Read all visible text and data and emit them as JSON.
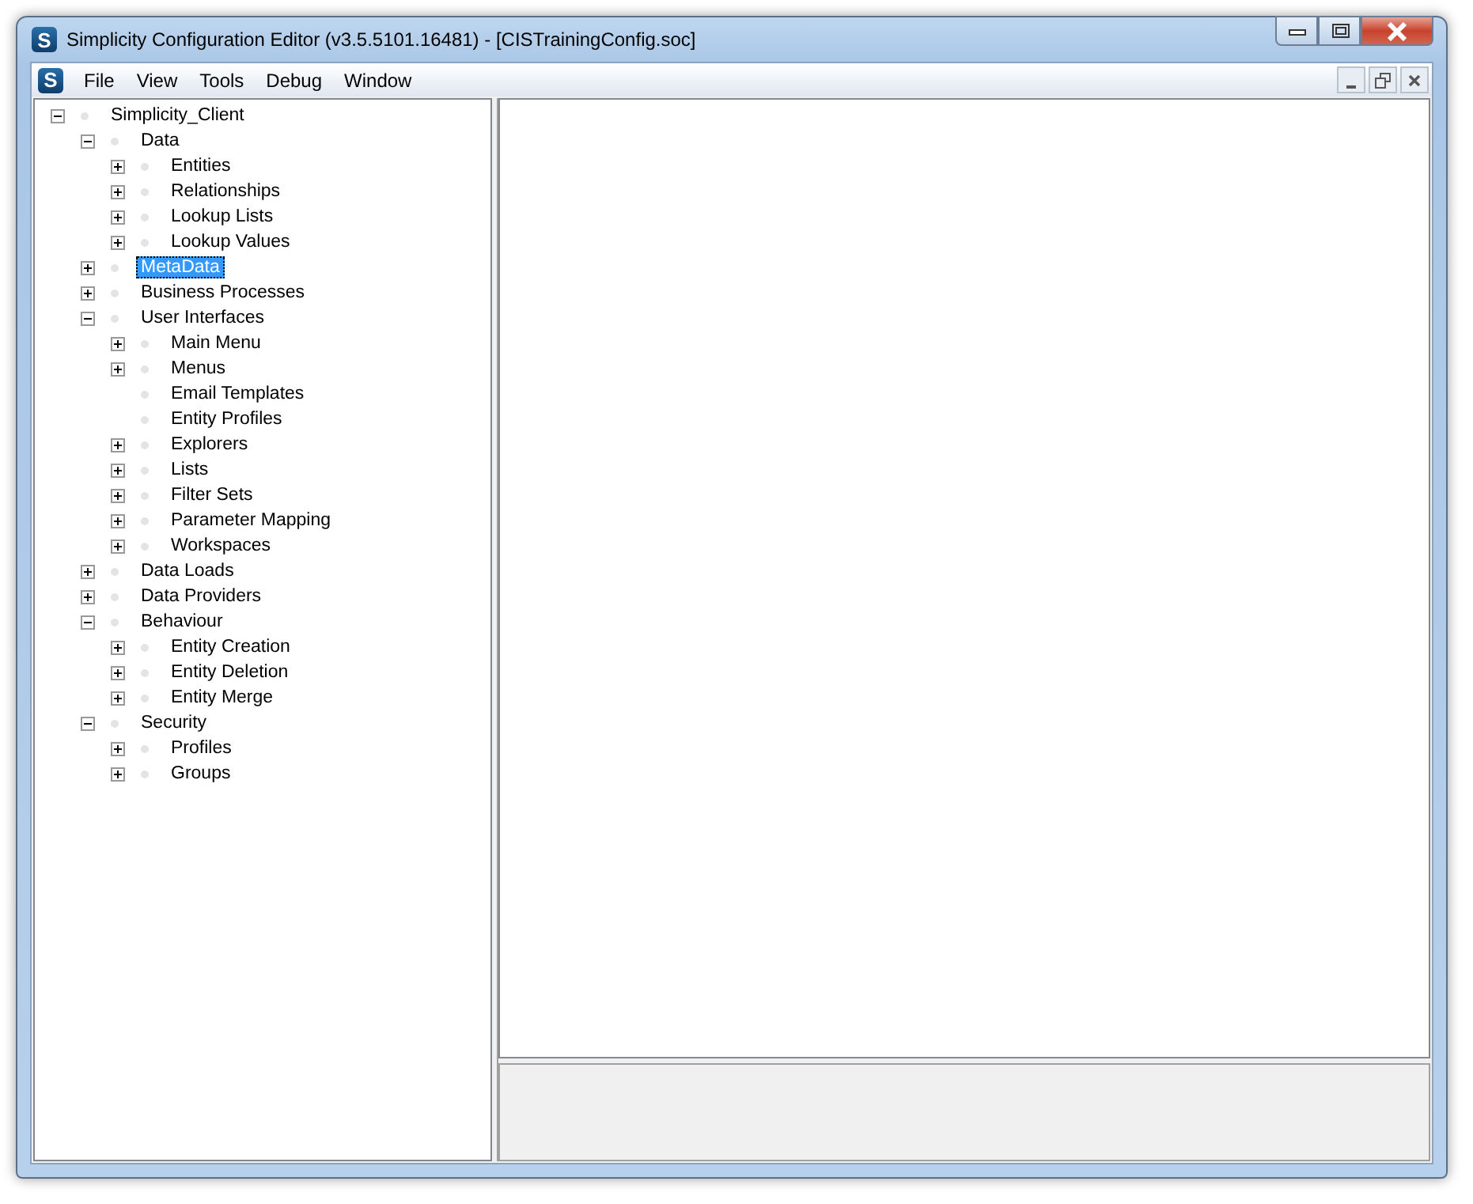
{
  "window": {
    "icon_letter": "S",
    "title": "Simplicity Configuration Editor (v3.5.5101.16481) - [CISTrainingConfig.soc]"
  },
  "menu_bar": {
    "icon_letter": "S",
    "items": [
      "File",
      "View",
      "Tools",
      "Debug",
      "Window"
    ]
  },
  "tree": [
    {
      "label": "Simplicity_Client",
      "expandable": true,
      "expanded": true,
      "selected": false,
      "children": [
        {
          "label": "Data",
          "expandable": true,
          "expanded": true,
          "selected": false,
          "children": [
            {
              "label": "Entities",
              "expandable": true,
              "expanded": false,
              "selected": false
            },
            {
              "label": "Relationships",
              "expandable": true,
              "expanded": false,
              "selected": false
            },
            {
              "label": "Lookup Lists",
              "expandable": true,
              "expanded": false,
              "selected": false
            },
            {
              "label": "Lookup Values",
              "expandable": true,
              "expanded": false,
              "selected": false
            }
          ]
        },
        {
          "label": "MetaData",
          "expandable": true,
          "expanded": false,
          "selected": true
        },
        {
          "label": "Business Processes",
          "expandable": true,
          "expanded": false,
          "selected": false
        },
        {
          "label": "User Interfaces",
          "expandable": true,
          "expanded": true,
          "selected": false,
          "children": [
            {
              "label": "Main Menu",
              "expandable": true,
              "expanded": false,
              "selected": false
            },
            {
              "label": "Menus",
              "expandable": true,
              "expanded": false,
              "selected": false
            },
            {
              "label": "Email Templates",
              "expandable": false,
              "selected": false
            },
            {
              "label": "Entity Profiles",
              "expandable": false,
              "selected": false
            },
            {
              "label": "Explorers",
              "expandable": true,
              "expanded": false,
              "selected": false
            },
            {
              "label": "Lists",
              "expandable": true,
              "expanded": false,
              "selected": false
            },
            {
              "label": "Filter Sets",
              "expandable": true,
              "expanded": false,
              "selected": false
            },
            {
              "label": "Parameter Mapping",
              "expandable": true,
              "expanded": false,
              "selected": false
            },
            {
              "label": "Workspaces",
              "expandable": true,
              "expanded": false,
              "selected": false
            }
          ]
        },
        {
          "label": "Data Loads",
          "expandable": true,
          "expanded": false,
          "selected": false
        },
        {
          "label": "Data Providers",
          "expandable": true,
          "expanded": false,
          "selected": false
        },
        {
          "label": "Behaviour",
          "expandable": true,
          "expanded": true,
          "selected": false,
          "children": [
            {
              "label": "Entity Creation",
              "expandable": true,
              "expanded": false,
              "selected": false
            },
            {
              "label": "Entity Deletion",
              "expandable": true,
              "expanded": false,
              "selected": false
            },
            {
              "label": "Entity Merge",
              "expandable": true,
              "expanded": false,
              "selected": false
            }
          ]
        },
        {
          "label": "Security",
          "expandable": true,
          "expanded": true,
          "selected": false,
          "children": [
            {
              "label": "Profiles",
              "expandable": true,
              "expanded": false,
              "selected": false
            },
            {
              "label": "Groups",
              "expandable": true,
              "expanded": false,
              "selected": false
            }
          ]
        }
      ]
    }
  ]
}
